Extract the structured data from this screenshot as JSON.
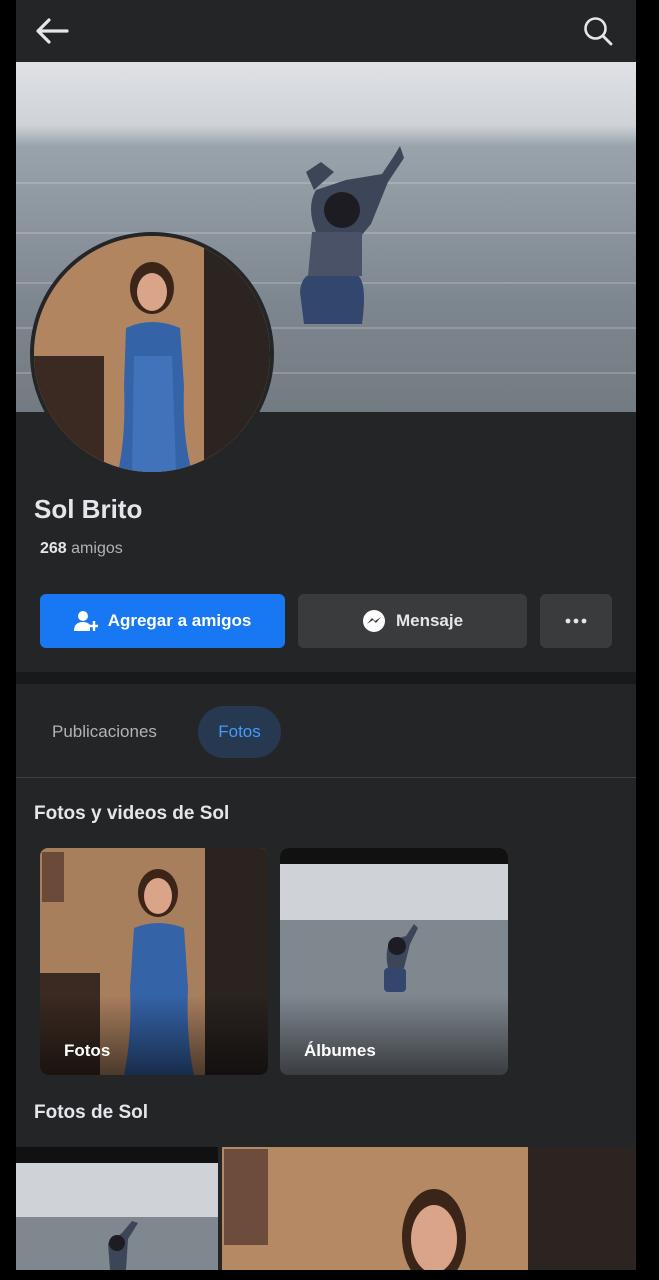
{
  "header": {
    "back_icon": "arrow-left-icon",
    "search_icon": "search-icon"
  },
  "profile": {
    "name": "Sol Brito",
    "friends_count": "268",
    "friends_label": "amigos"
  },
  "actions": {
    "add_friend_label": "Agregar a amigos",
    "add_friend_icon": "add-friend-icon",
    "message_label": "Mensaje",
    "message_icon": "messenger-icon",
    "more_icon": "more-horizontal-icon"
  },
  "tabs": [
    {
      "label": "Publicaciones",
      "active": false
    },
    {
      "label": "Fotos",
      "active": true
    }
  ],
  "photos_section": {
    "title": "Fotos y videos de Sol",
    "cards": [
      {
        "label": "Fotos"
      },
      {
        "label": "Álbumes"
      }
    ]
  },
  "gallery": {
    "title": "Fotos de Sol"
  },
  "colors": {
    "background": "#242527",
    "primary_button": "#1877f2",
    "secondary_button": "#3a3b3c",
    "active_tab_bg": "#263951",
    "active_tab_text": "#4599ff"
  }
}
